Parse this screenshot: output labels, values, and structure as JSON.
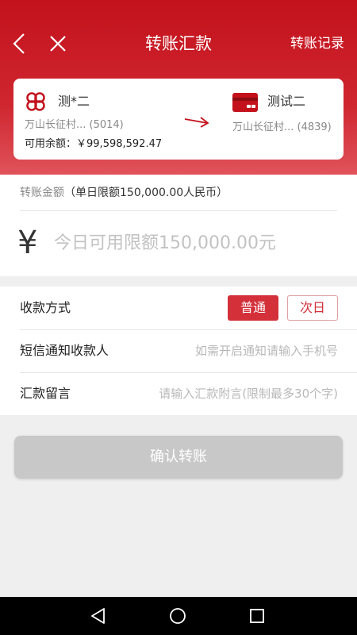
{
  "header": {
    "title": "转账汇款",
    "record_label": "转账记录",
    "back_icon": "back-arrow-icon",
    "close_icon": "close-icon"
  },
  "from_account": {
    "name": "测*二",
    "account": "万山长征村... (5014)",
    "balance_label": "可用余额：",
    "balance_value": "￥99,598,592.47",
    "icon": "bank-logo-icon"
  },
  "to_account": {
    "name": "测试二",
    "account": "万山长征村... (4839)",
    "icon": "bank-card-icon"
  },
  "amount": {
    "label": "转账金额",
    "limit": "（单日限额150,000.00人民币）",
    "currency": "¥",
    "placeholder": "今日可用限额150,000.00元"
  },
  "form": {
    "method_label": "收款方式",
    "method_options": [
      "普通",
      "次日"
    ],
    "method_selected": "普通",
    "sms_label": "短信通知收款人",
    "sms_placeholder": "如需开启通知请输入手机号",
    "message_label": "汇款留言",
    "message_placeholder": "请输入汇款附言(限制最多30个字)"
  },
  "confirm_label": "确认转账",
  "colors": {
    "brand_red": "#c3121c",
    "accent_red": "#d3303a",
    "disabled_gray": "#c8c8c8"
  }
}
